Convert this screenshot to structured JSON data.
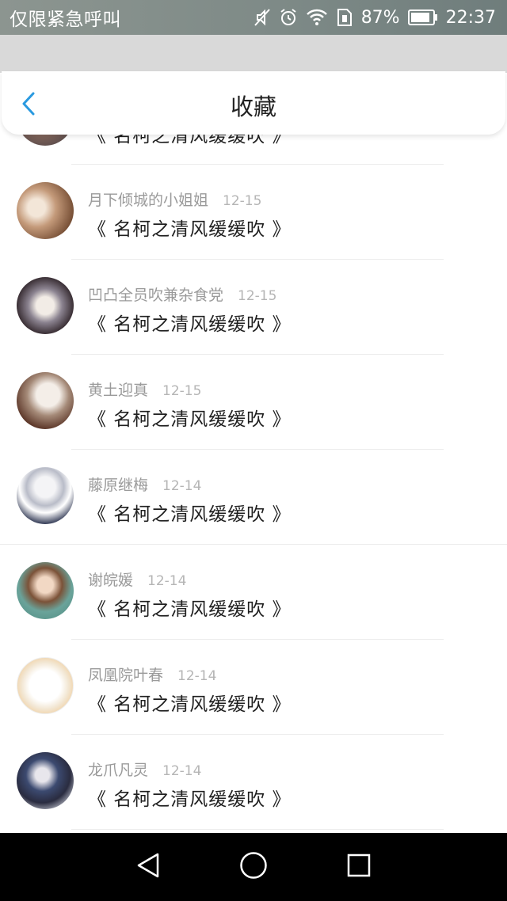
{
  "status_bar": {
    "carrier": "仅限紧急呼叫",
    "battery": "87%",
    "time": "22:37",
    "icons": [
      "mute-icon",
      "alarm-icon",
      "wifi-icon",
      "sim-icon",
      "battery-icon"
    ]
  },
  "header": {
    "title": "收藏",
    "back_icon": "chevron-left-icon"
  },
  "favorites": {
    "partial_title": "《 名柯之清风缓缓吹 》",
    "items": [
      {
        "user": "月下倾城的小姐姐",
        "date": "12-15",
        "title": "《 名柯之清风缓缓吹 》"
      },
      {
        "user": "凹凸全员吹兼杂食党",
        "date": "12-15",
        "title": "《 名柯之清风缓缓吹 》"
      },
      {
        "user": "黄土迎真",
        "date": "12-15",
        "title": "《 名柯之清风缓缓吹 》"
      },
      {
        "user": "藤原继梅",
        "date": "12-14",
        "title": "《 名柯之清风缓缓吹 》"
      },
      {
        "user": "谢皖媛",
        "date": "12-14",
        "title": "《 名柯之清风缓缓吹 》"
      },
      {
        "user": "凤凰院叶春",
        "date": "12-14",
        "title": "《 名柯之清风缓缓吹 》"
      },
      {
        "user": "龙爪凡灵",
        "date": "12-14",
        "title": "《 名柯之清风缓缓吹 》"
      }
    ]
  },
  "nav_bar": {
    "buttons": [
      "back-triangle-icon",
      "home-circle-icon",
      "recents-square-icon"
    ]
  },
  "colors": {
    "accent": "#2a9ae0",
    "title_text": "#1f1f1f",
    "meta_text": "#9a9a9a"
  }
}
